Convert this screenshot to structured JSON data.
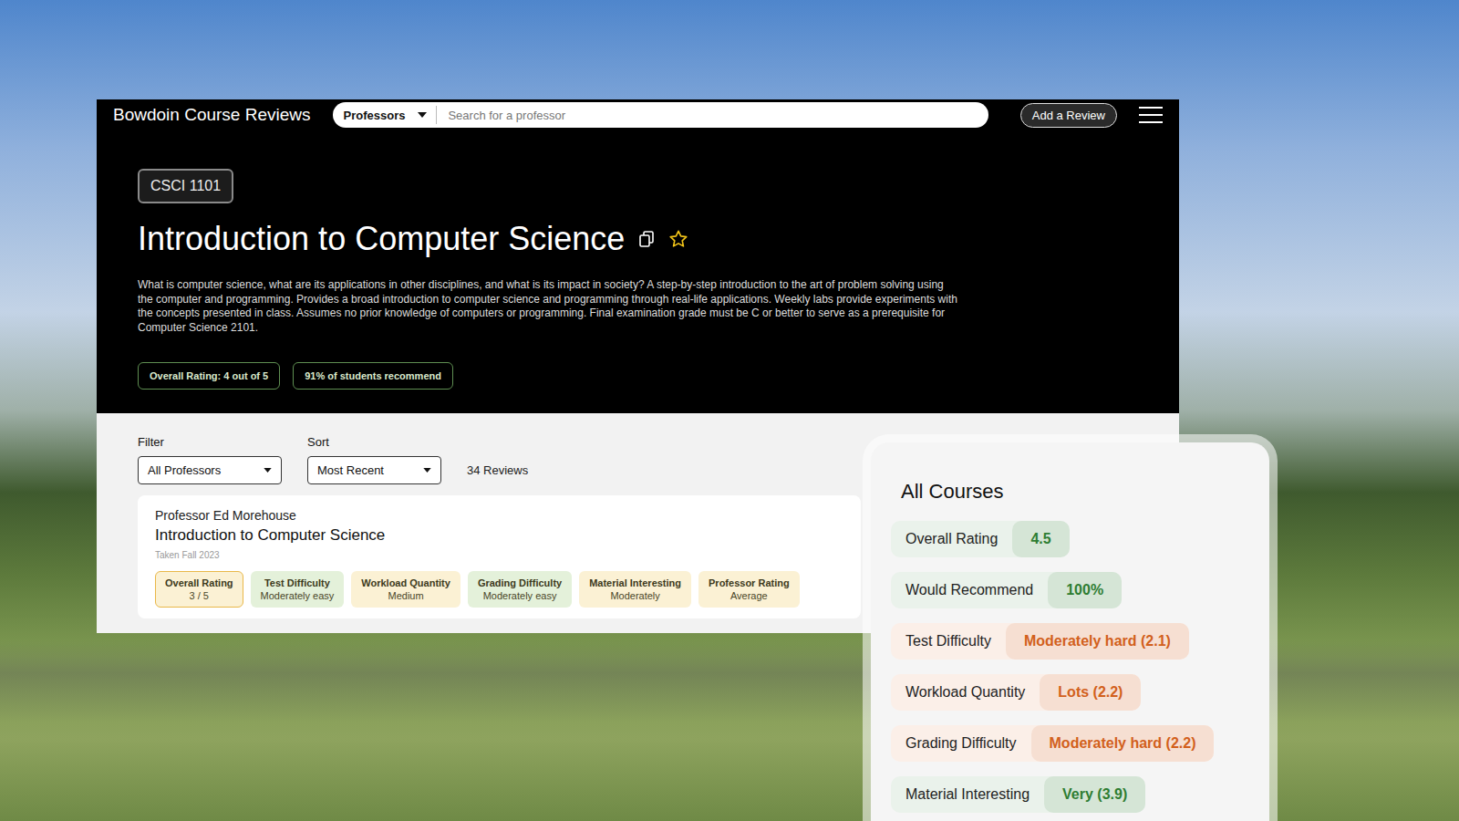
{
  "site": {
    "title": "Bowdoin Course Reviews"
  },
  "search": {
    "scope": "Professors",
    "placeholder": "Search for a professor"
  },
  "add_review_button": "Add a Review",
  "course": {
    "code": "CSCI 1101",
    "title": "Introduction to Computer Science",
    "favorited": false,
    "description": "What is computer science, what are its applications in other disciplines, and what is its impact in society? A step-by-step introduction to the art of problem solving using the computer and programming. Provides a broad introduction to computer science and programming through real-life applications. Weekly labs provide experiments with the concepts presented in class. Assumes no prior knowledge of computers or programming. Final examination grade must be C or better to serve as a prerequisite for Computer Science 2101.",
    "badges": [
      "Overall Rating: 4 out of 5",
      "91% of students recommend"
    ]
  },
  "filter": {
    "label": "Filter",
    "value": "All Professors"
  },
  "sort": {
    "label": "Sort",
    "value": "Most Recent"
  },
  "review_count": "34 Reviews",
  "reviews": [
    {
      "professor": "Professor Ed Morehouse",
      "course": "Introduction to Computer Science",
      "term": "Taken Fall 2023",
      "metrics": [
        {
          "label": "Overall Rating",
          "value": "3 / 5",
          "color": "#fbf1d4",
          "outlined": true
        },
        {
          "label": "Test Difficulty",
          "value": "Moderately easy",
          "color": "#e4f1da",
          "outlined": false
        },
        {
          "label": "Workload Quantity",
          "value": "Medium",
          "color": "#fbf1d4",
          "outlined": false
        },
        {
          "label": "Grading Difficulty",
          "value": "Moderately easy",
          "color": "#e4f1da",
          "outlined": false
        },
        {
          "label": "Material Interesting",
          "value": "Moderately",
          "color": "#fbf1d4",
          "outlined": false
        },
        {
          "label": "Professor Rating",
          "value": "Average",
          "color": "#fbf1d4",
          "outlined": false
        }
      ]
    }
  ],
  "summary": {
    "title": "All Courses",
    "rows": [
      {
        "label": "Overall Rating",
        "value": "4.5",
        "color": "#2e7d32"
      },
      {
        "label": "Would Recommend",
        "value": "100%",
        "color": "#2e7d32"
      },
      {
        "label": "Test Difficulty",
        "value": "Moderately hard (2.1)",
        "color": "#d2601c"
      },
      {
        "label": "Workload Quantity",
        "value": "Lots (2.2)",
        "color": "#d2601c"
      },
      {
        "label": "Grading Difficulty",
        "value": "Moderately hard (2.2)",
        "color": "#d2601c"
      },
      {
        "label": "Material Interesting",
        "value": "Very (3.9)",
        "color": "#2e7d32"
      }
    ]
  }
}
